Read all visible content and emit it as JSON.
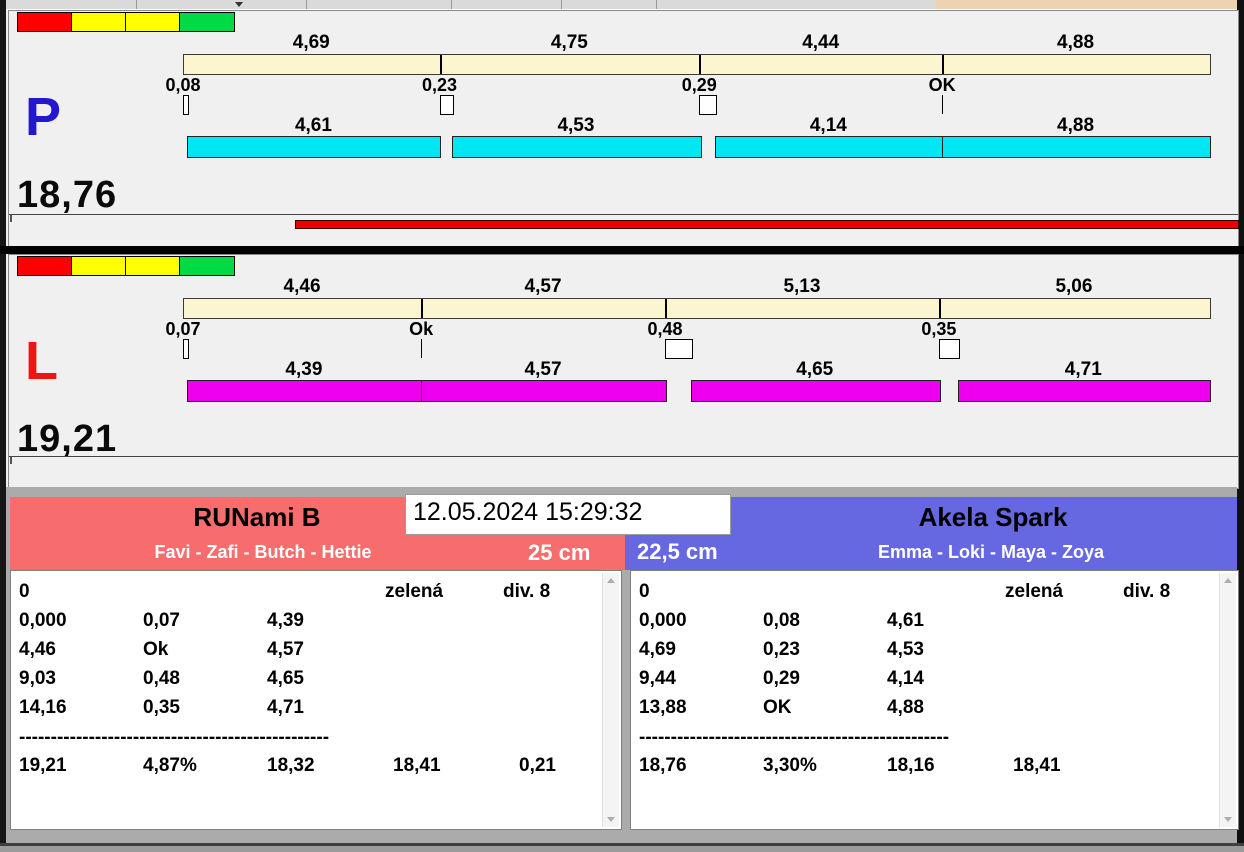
{
  "chrome": {
    "top_right_strip_color": "#EFD2B0",
    "toolbar_color": "#DADADA",
    "bottom_band_color": "#ABABAB"
  },
  "datetime": "12.05.2024 15:29:32",
  "lanes": [
    {
      "label": "P",
      "label_color": "#2418CE",
      "total": "18,76",
      "splits": [
        "4,69",
        "4,75",
        "4,44",
        "4,88"
      ],
      "faults": [
        "0,08",
        "0,23",
        "0,29",
        "OK"
      ],
      "dog_times": [
        "4,61",
        "4,53",
        "4,14",
        "4,88"
      ],
      "split_bar_color": "#FBF6D0",
      "dog_bar_color": "#00E6F2",
      "traffic_lights": [
        "#FF0000",
        "#FFFF00",
        "#FFFF00",
        "#00DB45"
      ],
      "progress_bar": {
        "visible": true,
        "color": "#E90000",
        "start_frac": 0.109,
        "end_frac": 1.027
      }
    },
    {
      "label": "L",
      "label_color": "#EE1414",
      "total": "19,21",
      "splits": [
        "4,46",
        "4,57",
        "5,13",
        "5,06"
      ],
      "faults": [
        "0,07",
        "Ok",
        "0,48",
        "0,35"
      ],
      "dog_times": [
        "4,39",
        "4,57",
        "4,65",
        "4,71"
      ],
      "split_bar_color": "#FBF6D0",
      "dog_bar_color": "#EE00EE",
      "traffic_lights": [
        "#FF0000",
        "#FFFF00",
        "#FFFF00",
        "#00DB45"
      ],
      "progress_bar": {
        "visible": false
      }
    }
  ],
  "teams": [
    {
      "name": "RUNami B",
      "dogs": "Favi - Zafi - Butch - Hettie",
      "jump_height": "25 cm",
      "header_color": "#F76C6C",
      "table": {
        "status_left": "0",
        "status_color_label": "zelená",
        "status_division": "div. 8",
        "rows": [
          [
            "0,000",
            "0,07",
            "4,39"
          ],
          [
            "4,46",
            "Ok",
            "4,57"
          ],
          [
            "9,03",
            "0,48",
            "4,65"
          ],
          [
            "14,16",
            "0,35",
            "4,71"
          ]
        ],
        "separator": "-------------------------------------------------",
        "summary": [
          "19,21",
          "4,87%",
          "18,32",
          "18,41",
          "0,21"
        ]
      }
    },
    {
      "name": "Akela Spark",
      "dogs": "Emma - Loki - Maya - Zoya",
      "jump_height": "22,5 cm",
      "header_color": "#6668E2",
      "table": {
        "status_left": "0",
        "status_color_label": "zelená",
        "status_division": "div. 8",
        "rows": [
          [
            "0,000",
            "0,08",
            "4,61"
          ],
          [
            "4,69",
            "0,23",
            "4,53"
          ],
          [
            "9,44",
            "0,29",
            "4,14"
          ],
          [
            "13,88",
            "OK",
            "4,88"
          ]
        ],
        "separator": "-------------------------------------------------",
        "summary": [
          "18,76",
          "3,30%",
          "18,16",
          "18,41"
        ]
      }
    }
  ]
}
